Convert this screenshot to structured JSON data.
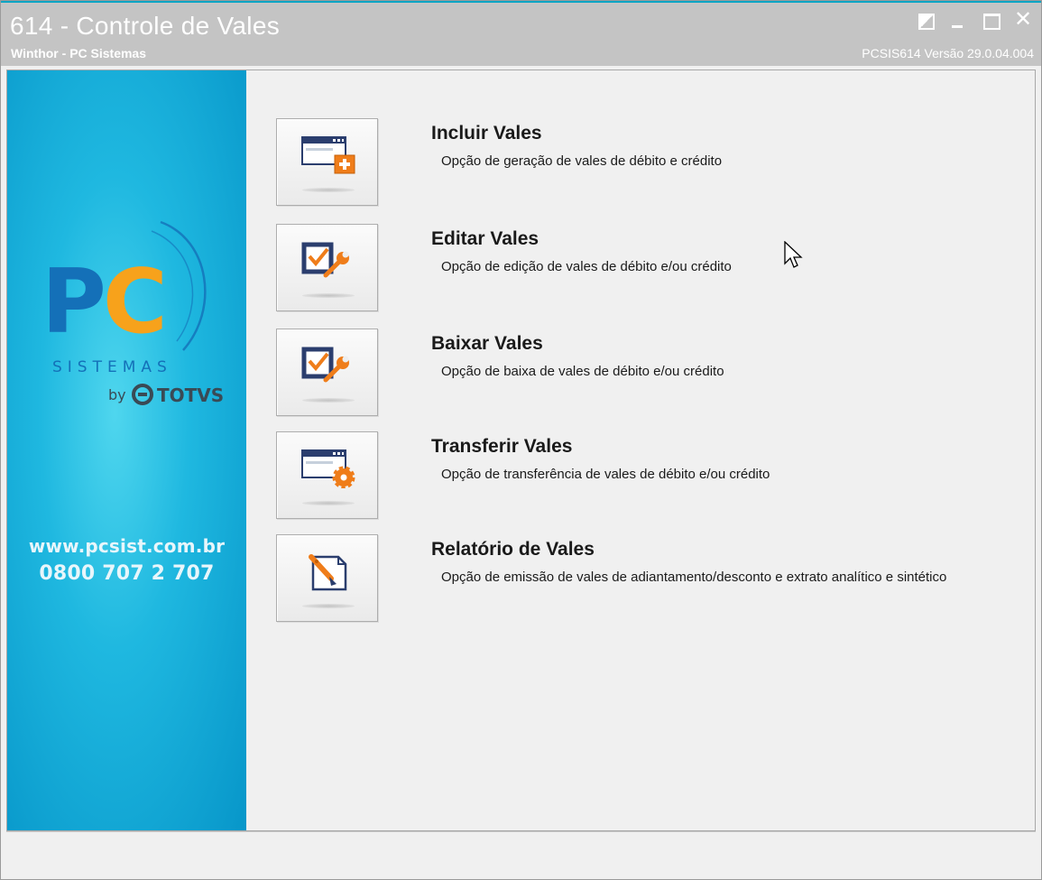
{
  "window": {
    "title": "614 - Controle de Vales",
    "subtitle": "Winthor - PC Sistemas",
    "version": "PCSIS614  Versão  29.0.04.004",
    "controls": [
      {
        "name": "restore-alt",
        "icon": "half-filled-square-icon"
      },
      {
        "name": "minimize",
        "icon": "minimize-icon"
      },
      {
        "name": "maximize",
        "icon": "maximize-icon"
      },
      {
        "name": "close",
        "label": "✕",
        "icon": "close-icon"
      }
    ],
    "accent_color": "#00a5c4"
  },
  "banner": {
    "logo_text": "PC",
    "logo_sub": "SISTEMAS",
    "by_text": "by",
    "partner": "TOTVS",
    "website": "www.pcsist.com.br",
    "phone": "0800 707 2 707",
    "colors": {
      "pc_blue": "#1470b8",
      "pc_orange": "#f7a21b",
      "background": "#1fb8e0"
    }
  },
  "menu": {
    "items": [
      {
        "title": "Incluir Vales",
        "description": "Opção de geração de vales de débito e crédito",
        "icon": "window-add-icon"
      },
      {
        "title": "Editar Vales",
        "description": "Opção de edição de vales de débito e/ou crédito",
        "icon": "checkbox-wrench-icon"
      },
      {
        "title": "Baixar Vales",
        "description": "Opção de baixa de vales de débito e/ou crédito",
        "icon": "checkbox-wrench-icon"
      },
      {
        "title": "Transferir Vales",
        "description": "Opção de transferência de vales de débito e/ou crédito",
        "icon": "window-gear-icon"
      },
      {
        "title": "Relatório de Vales",
        "description": "Opção de emissão de vales de adiantamento/desconto e extrato analítico e sintético",
        "icon": "document-pen-icon"
      }
    ]
  }
}
